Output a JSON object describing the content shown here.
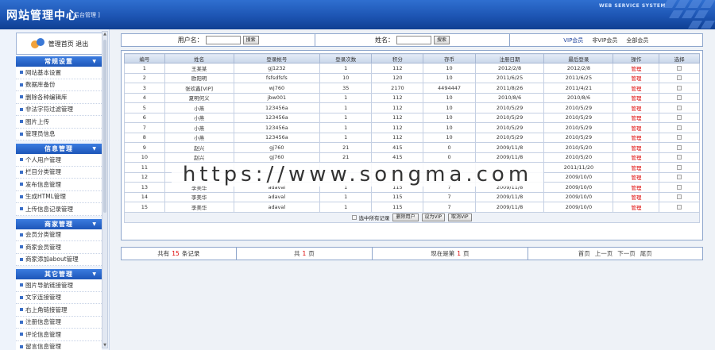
{
  "header": {
    "title": "网站管理中心",
    "subtitle": "[ 后台管理 ]",
    "system_label": "WEB SERVICE SYSTEM"
  },
  "sidebar": {
    "login_text": "管理首页 退出",
    "groups": [
      {
        "title": "常规设置",
        "items": [
          "网站基本设置",
          "数据库备份",
          "删除各种编辑库",
          "非法字符过滤管理",
          "图片上传",
          "管理员信息"
        ]
      },
      {
        "title": "信息管理",
        "items": [
          "个人用户管理",
          "栏目分类管理",
          "发布信息管理",
          "生成HTML管理",
          "上传信息记录管理"
        ]
      },
      {
        "title": "商家管理",
        "items": [
          "会员分类管理",
          "商家会员管理",
          "商家添加about管理"
        ]
      },
      {
        "title": "其它管理",
        "items": [
          "图片导航链接管理",
          "文字连接管理",
          "右上角链接管理",
          "注册信息管理",
          "评论信息管理",
          "留言信息管理"
        ]
      }
    ]
  },
  "search": {
    "username_label": "用户名：",
    "search_btn": "搜索",
    "name_label": "姓名：",
    "name_search_btn": "搜索",
    "links": [
      "VIP会员",
      "非VIP会员",
      "全部会员"
    ]
  },
  "table": {
    "headers": [
      "编号",
      "姓名",
      "登录帐号",
      "登录次数",
      "积分",
      "存币",
      "注册日期",
      "最后登录",
      "操作",
      "选择"
    ],
    "rows": [
      [
        "1",
        "王某某",
        "gj1232",
        "1",
        "112",
        "10",
        "2012/2/8",
        "2012/2/8",
        "管理"
      ],
      [
        "2",
        "欧阳明",
        "fsfsdfsfs",
        "10",
        "120",
        "10",
        "2011/6/25",
        "2011/6/25",
        "管理"
      ],
      [
        "3",
        "张欢鑫[VIP]",
        "wj760",
        "35",
        "2170",
        "4494447",
        "2011/8/26",
        "2011/4/21",
        "管理"
      ],
      [
        "4",
        "夏明何义",
        "jbw001",
        "1",
        "112",
        "10",
        "2010/8/6",
        "2010/8/6",
        "管理"
      ],
      [
        "5",
        "小燕",
        "123456a",
        "1",
        "112",
        "10",
        "2010/5/29",
        "2010/5/29",
        "管理"
      ],
      [
        "6",
        "小燕",
        "123456a",
        "1",
        "112",
        "10",
        "2010/5/29",
        "2010/5/29",
        "管理"
      ],
      [
        "7",
        "小燕",
        "123456a",
        "1",
        "112",
        "10",
        "2010/5/29",
        "2010/5/29",
        "管理"
      ],
      [
        "8",
        "小燕",
        "123456a",
        "1",
        "112",
        "10",
        "2010/5/29",
        "2010/5/29",
        "管理"
      ],
      [
        "9",
        "赵兴",
        "gj760",
        "21",
        "415",
        "0",
        "2009/11/8",
        "2010/5/20",
        "管理"
      ],
      [
        "10",
        "赵兴",
        "gj760",
        "21",
        "415",
        "0",
        "2009/11/8",
        "2010/5/20",
        "管理"
      ],
      [
        "11",
        "",
        "",
        "",
        "",
        "",
        "",
        "2011/11/20",
        "管理"
      ],
      [
        "12",
        "",
        "",
        "",
        "",
        "",
        "",
        "2009/10/0",
        "管理"
      ],
      [
        "13",
        "李美华",
        "adaval",
        "1",
        "115",
        "7",
        "2009/11/8",
        "2009/10/0",
        "管理"
      ],
      [
        "14",
        "李美华",
        "adaval",
        "1",
        "115",
        "7",
        "2009/11/8",
        "2009/10/0",
        "管理"
      ],
      [
        "15",
        "李美华",
        "adaval",
        "1",
        "115",
        "7",
        "2009/11/8",
        "2009/10/0",
        "管理"
      ]
    ],
    "select_all_label": "选中所有记录",
    "action_buttons": [
      "删除用户",
      "设为VIP",
      "取消VIP"
    ]
  },
  "pager": {
    "total_prefix": "共有",
    "total_count": "15",
    "total_suffix": "条记录",
    "pages_prefix": "共",
    "pages_count": "1",
    "pages_suffix": "页",
    "current_prefix": "现在是第",
    "current_page": "1",
    "current_suffix": "页",
    "links": [
      "首页",
      "上一页",
      "下一页",
      "尾页"
    ]
  },
  "watermark": "https://www.songma.com"
}
